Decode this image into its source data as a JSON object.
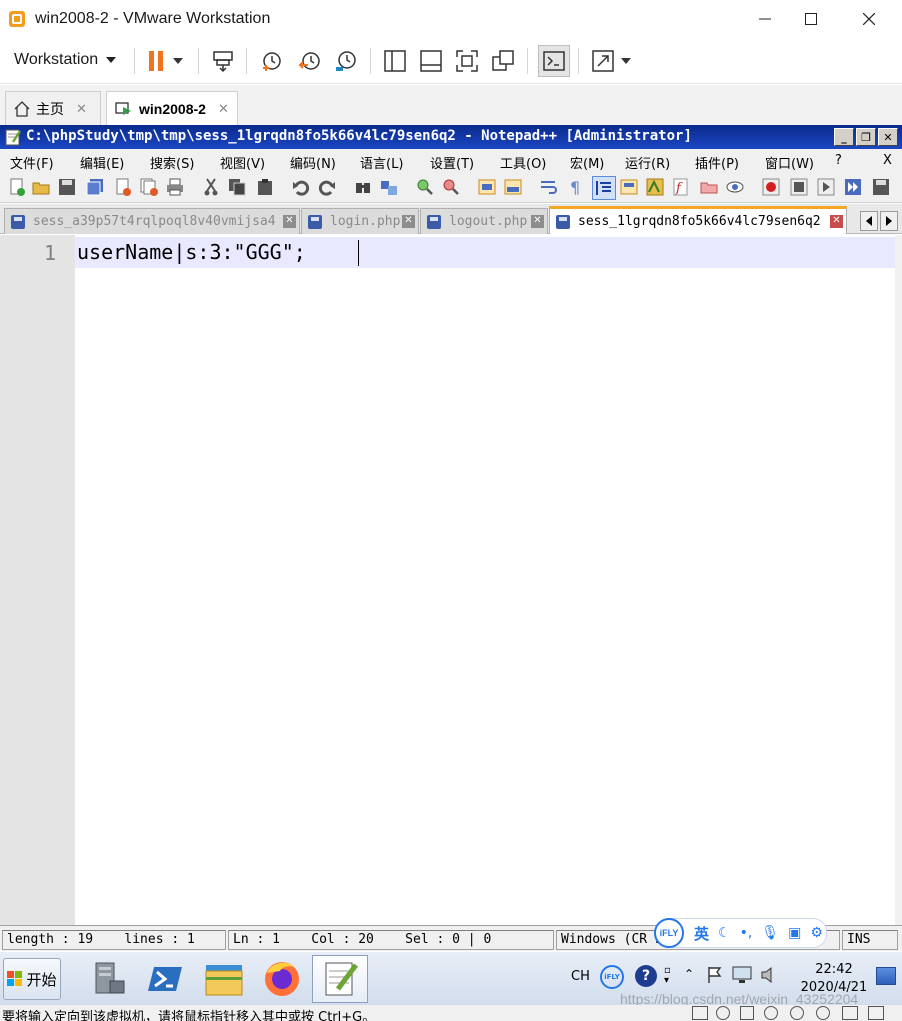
{
  "vmware": {
    "title": "win2008-2 - VMware Workstation",
    "workstation_menu": "Workstation",
    "tabs": [
      {
        "label": "主页"
      },
      {
        "label": "win2008-2"
      }
    ],
    "tab_close": "✕"
  },
  "notepad": {
    "title": "C:\\phpStudy\\tmp\\tmp\\sess_1lgrqdn8fo5k66v4lc79sen6q2 - Notepad++ [Administrator]",
    "close_x": "X",
    "menus": [
      "文件(F)",
      "编辑(E)",
      "搜索(S)",
      "视图(V)",
      "编码(N)",
      "语言(L)",
      "设置(T)",
      "工具(O)",
      "宏(M)",
      "运行(R)",
      "插件(P)",
      "窗口(W)",
      "?"
    ],
    "tabs": [
      {
        "label": "sess_a39p57t4rqlpoql8v40vmijsa4"
      },
      {
        "label": "login.php"
      },
      {
        "label": "logout.php"
      },
      {
        "label": "sess_1lgrqdn8fo5k66v4lc79sen6q2"
      }
    ],
    "editor": {
      "line_number": "1",
      "code": "userName|s:3:\"GGG\";"
    },
    "status": {
      "length_lines": "length : 19    lines : 1",
      "position": "Ln : 1    Col : 20    Sel : 0 | 0",
      "eol": "Windows (CR LF)",
      "mode": "INS"
    }
  },
  "ime": {
    "logo": "iFLY",
    "lang": "英"
  },
  "taskbar": {
    "start_label": "开始",
    "tray_lang": "CH",
    "clock_time": "22:42",
    "clock_date": "2020/4/21"
  },
  "hint": {
    "text": "要将输入定向到该虚拟机，请将鼠标指针移入其中或按 Ctrl+G。"
  },
  "watermark": "https://blog.csdn.net/weixin_43252204"
}
